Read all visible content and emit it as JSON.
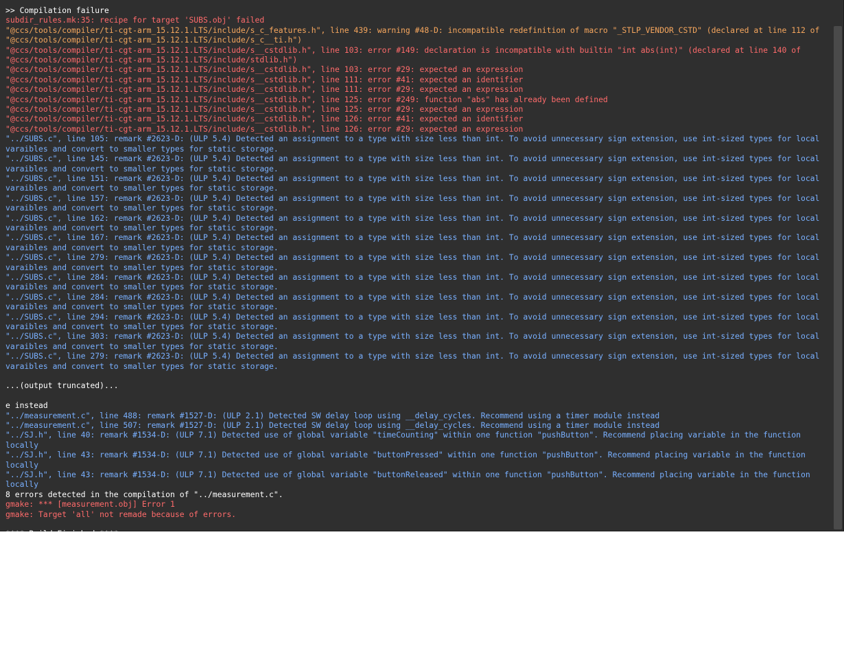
{
  "colors": {
    "background": "#2f2f2f",
    "normal": "#ffffff",
    "error": "#ff6b6b",
    "warning": "#f7a75e",
    "remark": "#79b0ff"
  },
  "console": {
    "lines": [
      {
        "type": "normal",
        "text": ">> Compilation failure"
      },
      {
        "type": "error",
        "text": "subdir_rules.mk:35: recipe for target 'SUBS.obj' failed"
      },
      {
        "type": "warning",
        "text": "\"@ccs/tools/compiler/ti-cgt-arm_15.12.1.LTS/include/s_c_features.h\", line 439: warning #48-D: incompatible redefinition of macro \"_STLP_VENDOR_CSTD\" (declared at line 112 of \"@ccs/tools/compiler/ti-cgt-arm_15.12.1.LTS/include/s_c__ti.h\")"
      },
      {
        "type": "error",
        "text": "\"@ccs/tools/compiler/ti-cgt-arm_15.12.1.LTS/include/s__cstdlib.h\", line 103: error #149: declaration is incompatible with builtin \"int abs(int)\" (declared at line 140 of \"@ccs/tools/compiler/ti-cgt-arm_15.12.1.LTS/include/stdlib.h\")"
      },
      {
        "type": "error",
        "text": "\"@ccs/tools/compiler/ti-cgt-arm_15.12.1.LTS/include/s__cstdlib.h\", line 103: error #29: expected an expression"
      },
      {
        "type": "error",
        "text": "\"@ccs/tools/compiler/ti-cgt-arm_15.12.1.LTS/include/s__cstdlib.h\", line 111: error #41: expected an identifier"
      },
      {
        "type": "error",
        "text": "\"@ccs/tools/compiler/ti-cgt-arm_15.12.1.LTS/include/s__cstdlib.h\", line 111: error #29: expected an expression"
      },
      {
        "type": "error",
        "text": "\"@ccs/tools/compiler/ti-cgt-arm_15.12.1.LTS/include/s__cstdlib.h\", line 125: error #249: function \"abs\" has already been defined"
      },
      {
        "type": "error",
        "text": "\"@ccs/tools/compiler/ti-cgt-arm_15.12.1.LTS/include/s__cstdlib.h\", line 125: error #29: expected an expression"
      },
      {
        "type": "error",
        "text": "\"@ccs/tools/compiler/ti-cgt-arm_15.12.1.LTS/include/s__cstdlib.h\", line 126: error #41: expected an identifier"
      },
      {
        "type": "error",
        "text": "\"@ccs/tools/compiler/ti-cgt-arm_15.12.1.LTS/include/s__cstdlib.h\", line 126: error #29: expected an expression"
      },
      {
        "type": "remark",
        "text": "\"../SUBS.c\", line 105: remark #2623-D: (ULP 5.4) Detected an assignment to a type with size less than int. To avoid unnecessary sign extension, use int-sized types for local varaibles and convert to smaller types for static storage."
      },
      {
        "type": "remark",
        "text": "\"../SUBS.c\", line 145: remark #2623-D: (ULP 5.4) Detected an assignment to a type with size less than int. To avoid unnecessary sign extension, use int-sized types for local varaibles and convert to smaller types for static storage."
      },
      {
        "type": "remark",
        "text": "\"../SUBS.c\", line 151: remark #2623-D: (ULP 5.4) Detected an assignment to a type with size less than int. To avoid unnecessary sign extension, use int-sized types for local varaibles and convert to smaller types for static storage."
      },
      {
        "type": "remark",
        "text": "\"../SUBS.c\", line 157: remark #2623-D: (ULP 5.4) Detected an assignment to a type with size less than int. To avoid unnecessary sign extension, use int-sized types for local varaibles and convert to smaller types for static storage."
      },
      {
        "type": "remark",
        "text": "\"../SUBS.c\", line 162: remark #2623-D: (ULP 5.4) Detected an assignment to a type with size less than int. To avoid unnecessary sign extension, use int-sized types for local varaibles and convert to smaller types for static storage."
      },
      {
        "type": "remark",
        "text": "\"../SUBS.c\", line 167: remark #2623-D: (ULP 5.4) Detected an assignment to a type with size less than int. To avoid unnecessary sign extension, use int-sized types for local varaibles and convert to smaller types for static storage."
      },
      {
        "type": "remark",
        "text": "\"../SUBS.c\", line 279: remark #2623-D: (ULP 5.4) Detected an assignment to a type with size less than int. To avoid unnecessary sign extension, use int-sized types for local varaibles and convert to smaller types for static storage."
      },
      {
        "type": "remark",
        "text": "\"../SUBS.c\", line 284: remark #2623-D: (ULP 5.4) Detected an assignment to a type with size less than int. To avoid unnecessary sign extension, use int-sized types for local varaibles and convert to smaller types for static storage."
      },
      {
        "type": "remark",
        "text": "\"../SUBS.c\", line 284: remark #2623-D: (ULP 5.4) Detected an assignment to a type with size less than int. To avoid unnecessary sign extension, use int-sized types for local varaibles and convert to smaller types for static storage."
      },
      {
        "type": "remark",
        "text": "\"../SUBS.c\", line 294: remark #2623-D: (ULP 5.4) Detected an assignment to a type with size less than int. To avoid unnecessary sign extension, use int-sized types for local varaibles and convert to smaller types for static storage."
      },
      {
        "type": "remark",
        "text": "\"../SUBS.c\", line 303: remark #2623-D: (ULP 5.4) Detected an assignment to a type with size less than int. To avoid unnecessary sign extension, use int-sized types for local varaibles and convert to smaller types for static storage."
      },
      {
        "type": "remark",
        "text": "\"../SUBS.c\", line 279: remark #2623-D: (ULP 5.4) Detected an assignment to a type with size less than int. To avoid unnecessary sign extension, use int-sized types for local varaibles and convert to smaller types for static storage."
      },
      {
        "type": "normal",
        "text": ""
      },
      {
        "type": "normal",
        "text": "...(output truncated)..."
      },
      {
        "type": "normal",
        "text": ""
      },
      {
        "type": "normal",
        "text": "e instead"
      },
      {
        "type": "remark",
        "text": "\"../measurement.c\", line 488: remark #1527-D: (ULP 2.1) Detected SW delay loop using __delay_cycles. Recommend using a timer module instead"
      },
      {
        "type": "remark",
        "text": "\"../measurement.c\", line 507: remark #1527-D: (ULP 2.1) Detected SW delay loop using __delay_cycles. Recommend using a timer module instead"
      },
      {
        "type": "remark",
        "text": "\"../SJ.h\", line 40: remark #1534-D: (ULP 7.1) Detected use of global variable \"timeCounting\" within one function \"pushButton\". Recommend placing variable in the function locally"
      },
      {
        "type": "remark",
        "text": "\"../SJ.h\", line 43: remark #1534-D: (ULP 7.1) Detected use of global variable \"buttonPressed\" within one function \"pushButton\". Recommend placing variable in the function locally"
      },
      {
        "type": "remark",
        "text": "\"../SJ.h\", line 43: remark #1534-D: (ULP 7.1) Detected use of global variable \"buttonReleased\" within one function \"pushButton\". Recommend placing variable in the function locally"
      },
      {
        "type": "normal",
        "text": "8 errors detected in the compilation of \"../measurement.c\"."
      },
      {
        "type": "error",
        "text": "gmake: *** [measurement.obj] Error 1"
      },
      {
        "type": "error",
        "text": "gmake: Target 'all' not remade because of errors."
      },
      {
        "type": "normal",
        "text": ""
      },
      {
        "type": "normal",
        "text": "**** Build Finished ****"
      }
    ]
  }
}
